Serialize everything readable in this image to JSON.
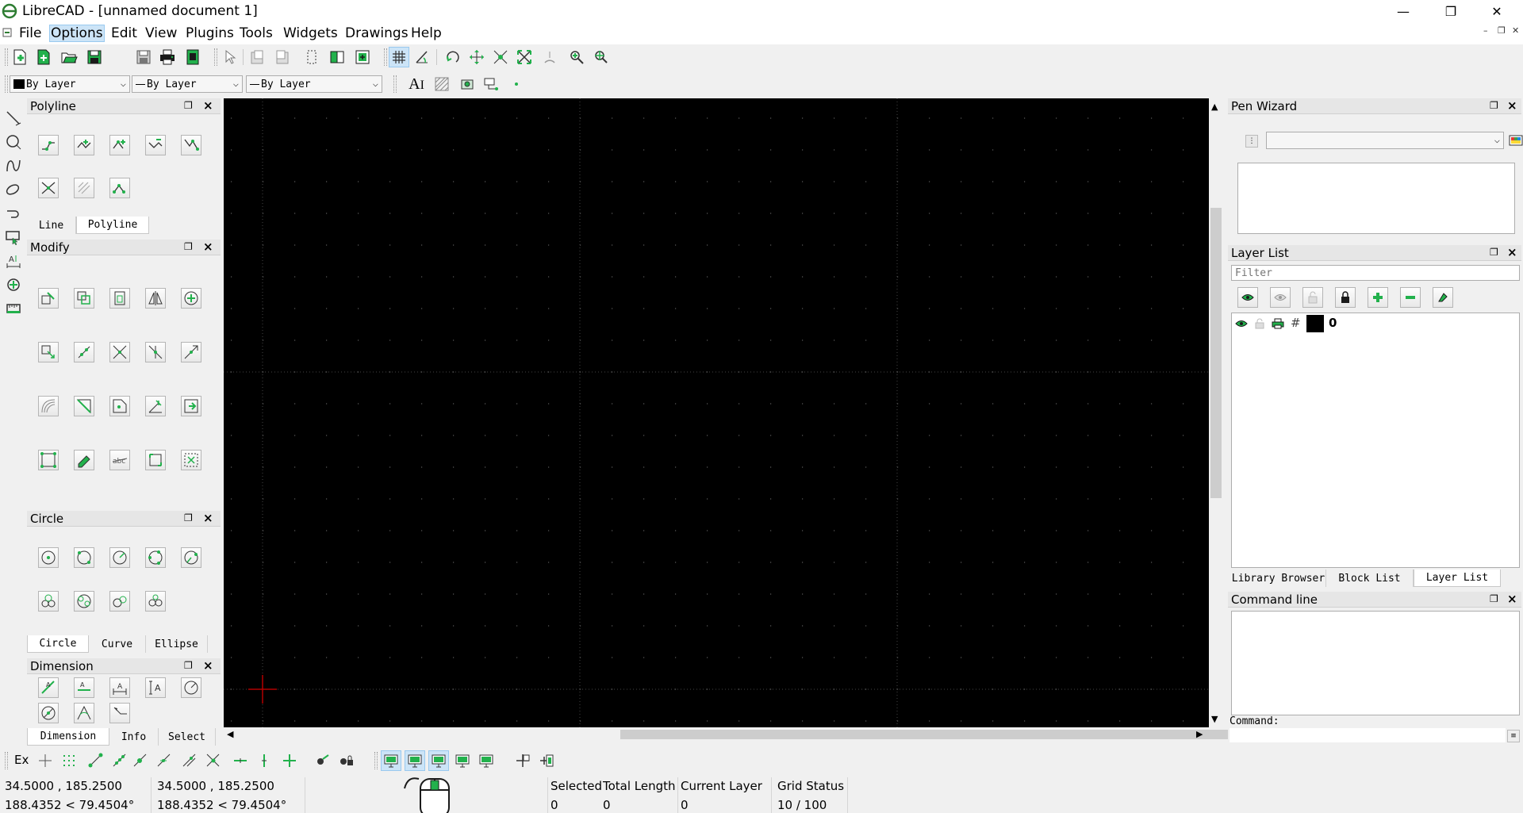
{
  "window": {
    "title": "LibreCAD - [unnamed document 1]",
    "controls": {
      "minimize": "—",
      "restore": "❐",
      "close": "✕"
    },
    "mdi_controls": {
      "minimize": "–",
      "restore": "❐",
      "close": "✕"
    }
  },
  "menubar": {
    "items": [
      "File",
      "Options",
      "Edit",
      "View",
      "Plugins",
      "Tools",
      "Widgets",
      "Drawings",
      "Help"
    ],
    "active": "Options"
  },
  "toolbar_file": {
    "buttons": [
      "new-file-icon",
      "new-from-template-icon",
      "open-icon",
      "save-icon",
      "save-as-icon",
      "print-icon",
      "print-preview-icon"
    ]
  },
  "toolbar_view": {
    "buttons": [
      "select-pointer-icon",
      "undo-icon",
      "redo-icon",
      "cut-icon",
      "copy-icon",
      "paste-icon",
      "grid-icon",
      "draft-icon",
      "redraw-icon",
      "zoom-in-icon",
      "zoom-out-icon",
      "zoom-auto-icon",
      "zoom-previous-icon",
      "zoom-window-icon",
      "zoom-pan-icon"
    ]
  },
  "pen_toolbar": {
    "color": "By Layer",
    "linetype": "By Layer",
    "width": "By Layer"
  },
  "text_toolbar": {
    "buttons": [
      "text-icon",
      "hatch-icon",
      "image-icon",
      "block-icon",
      "point-icon"
    ]
  },
  "left_toolbar": {
    "buttons": [
      "line-tool-icon",
      "circle-tool-icon",
      "curve-tool-icon",
      "ellipse-tool-icon",
      "polyline-tool-icon",
      "select-tool-icon",
      "dimension-tool-icon",
      "modify-tool-icon",
      "info-tool-icon"
    ]
  },
  "docks": {
    "polyline": {
      "title": "Polyline",
      "tools": [
        "polyline-create-icon",
        "polyline-add-node-icon",
        "polyline-append-node-icon",
        "polyline-delete-node-icon",
        "polyline-delete-between-icon",
        "polyline-trim-icon",
        "polyline-equidistant-icon",
        "polyline-from-segments-icon"
      ],
      "tabs": [
        "Line",
        "Polyline"
      ],
      "selected_tab": "Polyline"
    },
    "modify": {
      "title": "Modify",
      "tools": [
        "move-icon",
        "rotate-icon",
        "scale-icon",
        "mirror-icon",
        "move-rotate-icon",
        "rotate-two-icon",
        "trim-icon",
        "trim-two-icon",
        "divide-icon",
        "stretch-icon",
        "offset-icon",
        "bevel-icon",
        "fillet-icon",
        "lengthen-icon",
        "properties-icon",
        "attributes-icon",
        "entity-text-icon",
        "explode-text-icon",
        "revert-direction-icon",
        "delete-icon"
      ],
      "tabs": [],
      "selected_tab": ""
    },
    "circle": {
      "title": "Circle",
      "tools": [
        "circle-center-point-icon",
        "circle-two-points-icon",
        "circle-center-radius-icon",
        "circle-three-points-icon",
        "circle-two-points-radius-icon",
        "circle-tangent-two-icon",
        "circle-tangent-three-icon",
        "circle-tangent-point-icon",
        "circle-tangent-radius-icon"
      ],
      "tabs": [
        "Circle",
        "Curve",
        "Ellipse"
      ],
      "selected_tab": "Circle"
    },
    "dimension": {
      "title": "Dimension",
      "tools": [
        "dim-aligned-icon",
        "dim-linear-icon",
        "dim-horizontal-icon",
        "dim-vertical-icon",
        "dim-radial-icon",
        "dim-diametric-icon",
        "dim-angular-icon",
        "dim-leader-icon"
      ],
      "tabs": [
        "Dimension",
        "Info",
        "Select"
      ],
      "selected_tab": "Dimension"
    }
  },
  "pen_wizard": {
    "title": "Pen Wizard",
    "combo_value": ""
  },
  "layer_list": {
    "title": "Layer List",
    "filter_placeholder": "Filter",
    "toolbar": [
      "show-all-icon",
      "hide-all-icon",
      "unlock-all-icon",
      "lock-all-icon",
      "add-layer-icon",
      "remove-layer-icon",
      "edit-layer-icon"
    ],
    "layers": [
      {
        "name": "0",
        "visible": true,
        "locked": false,
        "print": true,
        "construction": false,
        "color": "#000000"
      }
    ],
    "tabs": [
      "Library Browser",
      "Block List",
      "Layer List"
    ],
    "selected_tab": "Layer List"
  },
  "command_line": {
    "title": "Command line",
    "prompt": "Command:",
    "value": ""
  },
  "snap_toolbar": {
    "label": "Ex",
    "buttons": [
      "snap-free-icon",
      "snap-grid-icon",
      "snap-endpoint-icon",
      "snap-on-entity-icon",
      "snap-center-icon",
      "snap-middle-icon",
      "snap-distance-icon",
      "snap-intersection-icon",
      "restrict-horizontal-icon",
      "restrict-vertical-icon",
      "restrict-orthogonal-icon",
      "relative-zero-icon",
      "lock-relative-zero-icon"
    ]
  },
  "view_toolbar": {
    "buttons": [
      "view-1-icon",
      "view-2-icon",
      "view-3-icon",
      "view-4-icon",
      "view-5-icon",
      "add-block-icon",
      "insert-block-icon"
    ]
  },
  "statusbar": {
    "abs_coord": "34.5000 , 185.2500",
    "abs_polar": "188.4352 < 79.4504°",
    "rel_coord": "34.5000 , 185.2500",
    "rel_polar": "188.4352 < 79.4504°",
    "selected_label": "Selected",
    "selected_value": "0",
    "total_length_label": "Total Length",
    "total_length_value": "0",
    "current_layer_label": "Current Layer",
    "current_layer_value": "0",
    "grid_status_label": "Grid Status",
    "grid_status_value": "10 / 100"
  },
  "colors": {
    "canvas": "#000000",
    "grid_dot": "#5a5a5a",
    "accent_green": "#22b14c",
    "crosshair": "#b30000"
  }
}
